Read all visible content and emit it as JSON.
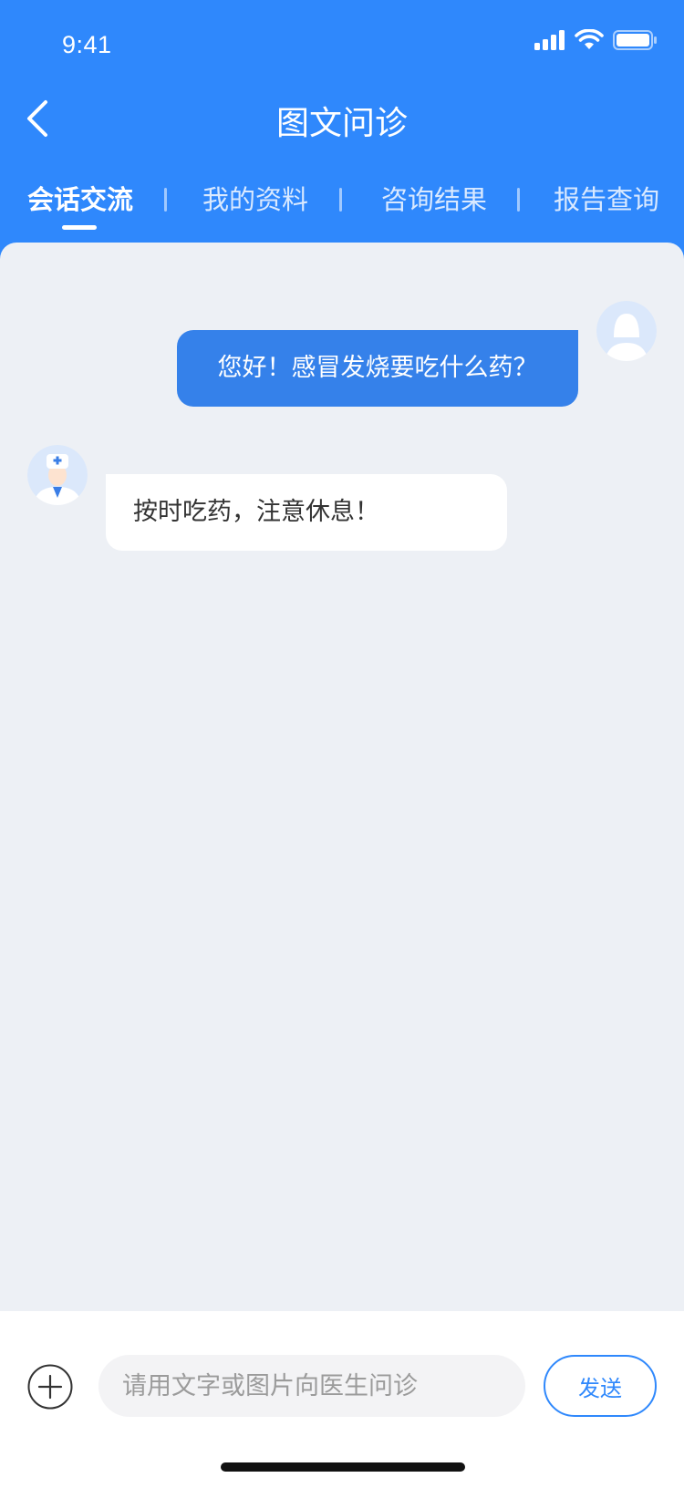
{
  "status_bar": {
    "time": "9:41",
    "signal_icon": "cellular-signal-icon",
    "wifi_icon": "wifi-icon",
    "battery_icon": "battery-icon"
  },
  "nav": {
    "title": "图文问诊",
    "back_icon": "chevron-left-icon"
  },
  "tabs": [
    {
      "label": "会话交流",
      "active": true
    },
    {
      "label": "我的资料",
      "active": false
    },
    {
      "label": "咨询结果",
      "active": false
    },
    {
      "label": "报告查询",
      "active": false
    }
  ],
  "messages": [
    {
      "from": "user",
      "avatar": "user-avatar-icon",
      "text": "您好！感冒发烧要吃什么药？"
    },
    {
      "from": "doctor",
      "avatar": "doctor-avatar-icon",
      "text": "按时吃药，注意休息！"
    }
  ],
  "input": {
    "placeholder": "请用文字或图片向医生问诊",
    "value": "",
    "add_icon": "plus-circle-icon"
  },
  "send_button": {
    "label": "发送"
  },
  "colors": {
    "primary": "#2f88fc",
    "bubble_out": "#3581ea",
    "chat_bg": "#edf0f5"
  }
}
